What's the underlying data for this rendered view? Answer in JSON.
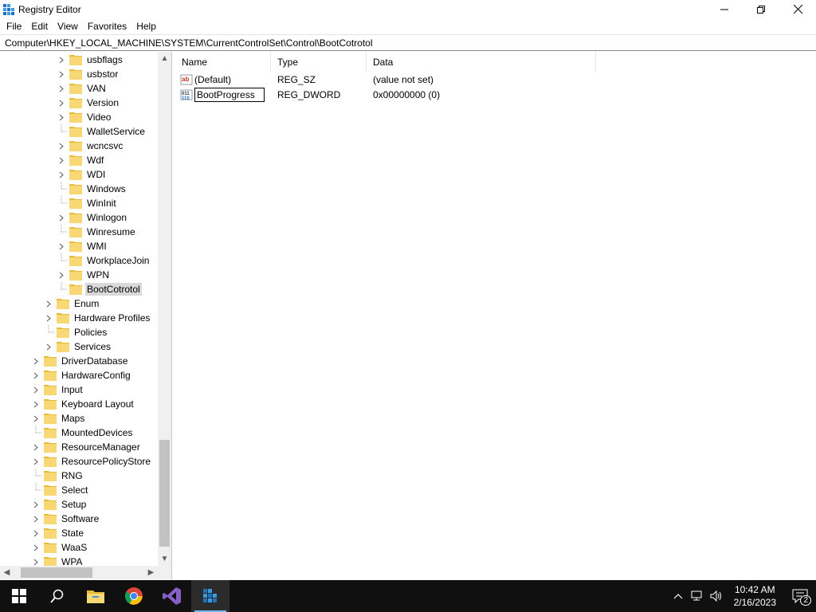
{
  "window": {
    "title": "Registry Editor",
    "icon": "registry-editor-icon"
  },
  "menu": [
    "File",
    "Edit",
    "View",
    "Favorites",
    "Help"
  ],
  "address": "Computer\\HKEY_LOCAL_MACHINE\\SYSTEM\\CurrentControlSet\\Control\\BootCotrotol",
  "tree": {
    "items": [
      {
        "label": "usbflags",
        "level": 3,
        "expandable": true
      },
      {
        "label": "usbstor",
        "level": 3,
        "expandable": true
      },
      {
        "label": "VAN",
        "level": 3,
        "expandable": true
      },
      {
        "label": "Version",
        "level": 3,
        "expandable": true
      },
      {
        "label": "Video",
        "level": 3,
        "expandable": true
      },
      {
        "label": "WalletService",
        "level": 3,
        "expandable": false
      },
      {
        "label": "wcncsvc",
        "level": 3,
        "expandable": true
      },
      {
        "label": "Wdf",
        "level": 3,
        "expandable": true
      },
      {
        "label": "WDI",
        "level": 3,
        "expandable": true
      },
      {
        "label": "Windows",
        "level": 3,
        "expandable": false
      },
      {
        "label": "WinInit",
        "level": 3,
        "expandable": false
      },
      {
        "label": "Winlogon",
        "level": 3,
        "expandable": true
      },
      {
        "label": "Winresume",
        "level": 3,
        "expandable": false
      },
      {
        "label": "WMI",
        "level": 3,
        "expandable": true
      },
      {
        "label": "WorkplaceJoin",
        "level": 3,
        "expandable": false
      },
      {
        "label": "WPN",
        "level": 3,
        "expandable": true
      },
      {
        "label": "BootCotrotol",
        "level": 3,
        "expandable": false,
        "selected": true
      },
      {
        "label": "Enum",
        "level": 2,
        "expandable": true
      },
      {
        "label": "Hardware Profiles",
        "level": 2,
        "expandable": true
      },
      {
        "label": "Policies",
        "level": 2,
        "expandable": false
      },
      {
        "label": "Services",
        "level": 2,
        "expandable": true
      },
      {
        "label": "DriverDatabase",
        "level": 1,
        "expandable": true
      },
      {
        "label": "HardwareConfig",
        "level": 1,
        "expandable": true
      },
      {
        "label": "Input",
        "level": 1,
        "expandable": true
      },
      {
        "label": "Keyboard Layout",
        "level": 1,
        "expandable": true
      },
      {
        "label": "Maps",
        "level": 1,
        "expandable": true
      },
      {
        "label": "MountedDevices",
        "level": 1,
        "expandable": false
      },
      {
        "label": "ResourceManager",
        "level": 1,
        "expandable": true
      },
      {
        "label": "ResourcePolicyStore",
        "level": 1,
        "expandable": true
      },
      {
        "label": "RNG",
        "level": 1,
        "expandable": false
      },
      {
        "label": "Select",
        "level": 1,
        "expandable": false
      },
      {
        "label": "Setup",
        "level": 1,
        "expandable": true
      },
      {
        "label": "Software",
        "level": 1,
        "expandable": true
      },
      {
        "label": "State",
        "level": 1,
        "expandable": true
      },
      {
        "label": "WaaS",
        "level": 1,
        "expandable": true
      },
      {
        "label": "WPA",
        "level": 1,
        "expandable": true
      }
    ]
  },
  "list": {
    "columns": {
      "name": "Name",
      "type": "Type",
      "data": "Data"
    },
    "rows": [
      {
        "name": "(Default)",
        "type": "REG_SZ",
        "data": "(value not set)",
        "icon": "string-value-icon"
      },
      {
        "name": "BootProgress",
        "type": "REG_DWORD",
        "data": "0x00000000 (0)",
        "icon": "binary-value-icon",
        "editing": true
      }
    ]
  },
  "taskbar": {
    "apps": [
      "start-icon",
      "search-icon",
      "file-explorer-icon",
      "chrome-icon",
      "visual-studio-icon",
      "registry-editor-icon"
    ],
    "clock": {
      "time": "10:42 AM",
      "date": "2/16/2023"
    },
    "notification_count": "2"
  },
  "colors": {
    "selection": "#d9d9d9",
    "folder": "#f8d775",
    "taskbar": "#101010",
    "accent": "#76b9ed"
  }
}
